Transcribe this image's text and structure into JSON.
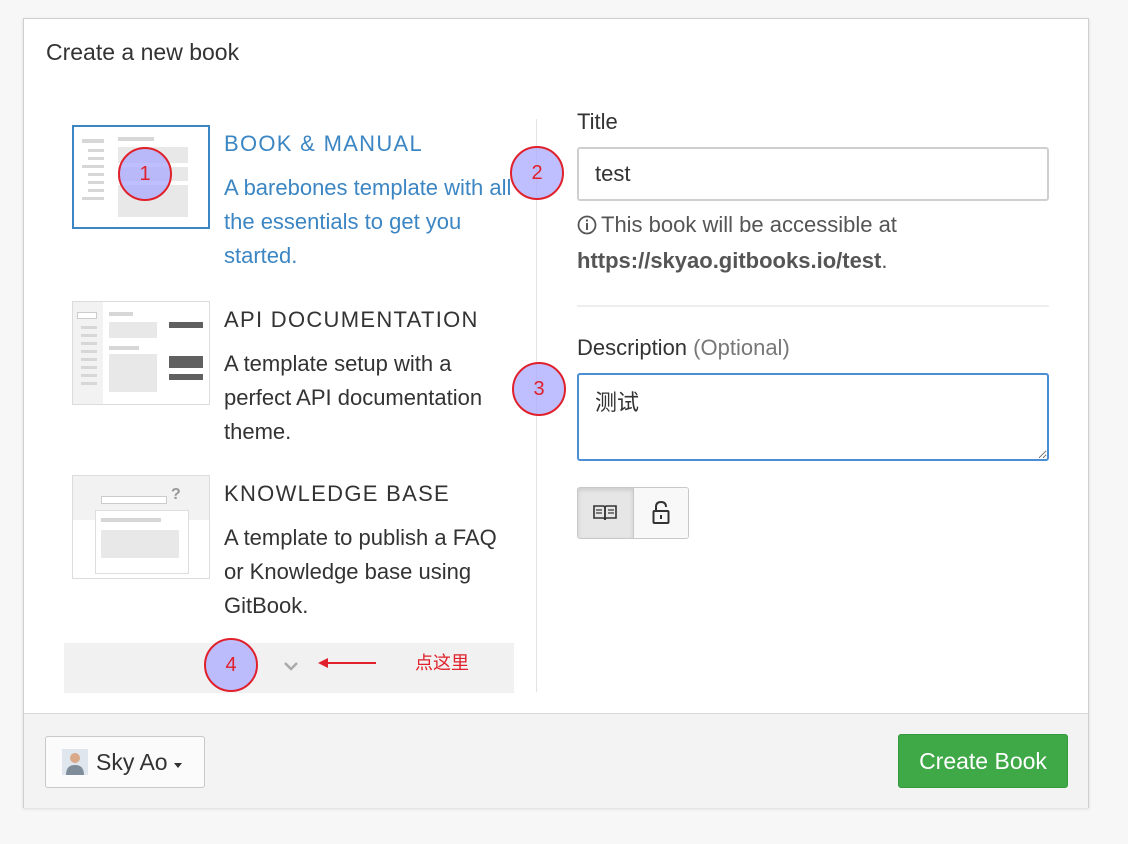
{
  "dialog": {
    "title": "Create a new book"
  },
  "templates": [
    {
      "title": "BOOK & MANUAL",
      "description": "A barebones template with all the essentials to get you started.",
      "selected": true
    },
    {
      "title": "API DOCUMENTATION",
      "description": "A template setup with a perfect API documentation theme.",
      "selected": false
    },
    {
      "title": "KNOWLEDGE BASE",
      "description": "A template to publish a FAQ or Knowledge base using GitBook.",
      "selected": false
    }
  ],
  "form": {
    "title_label": "Title",
    "title_value": "test",
    "hint_prefix": "This book will be accessible at",
    "hint_url": "https://skyao.gitbooks.io/test",
    "hint_suffix": ".",
    "description_label": "Description",
    "description_optional": "(Optional)",
    "description_value": "测试"
  },
  "footer": {
    "user_name": "Sky Ao",
    "create_label": "Create Book"
  },
  "annotations": {
    "markers": [
      "1",
      "2",
      "3",
      "4"
    ],
    "note": "点这里"
  },
  "colors": {
    "accent": "#3c86c3",
    "primary_button": "#3fa847",
    "annotation": "#e0202a"
  },
  "icons": [
    "info-icon",
    "book-icon",
    "lock-icon",
    "chevron-down-icon",
    "caret-down-icon"
  ]
}
